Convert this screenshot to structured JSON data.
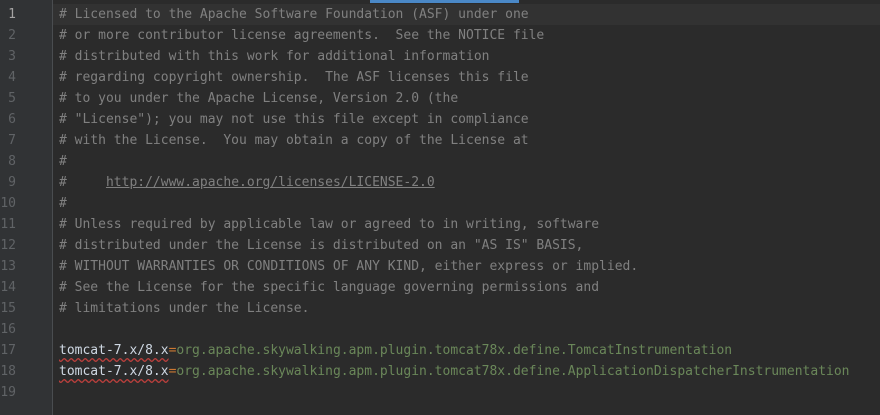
{
  "editor": {
    "current_line": 1,
    "line_numbers": [
      "1",
      "2",
      "3",
      "4",
      "5",
      "6",
      "7",
      "8",
      "9",
      "10",
      "11",
      "12",
      "13",
      "14",
      "15",
      "16",
      "17",
      "18",
      "19"
    ],
    "comments": [
      "# Licensed to the Apache Software Foundation (ASF) under one",
      "# or more contributor license agreements.  See the NOTICE file",
      "# distributed with this work for additional information",
      "# regarding copyright ownership.  The ASF licenses this file",
      "# to you under the Apache License, Version 2.0 (the",
      "# \"License\"); you may not use this file except in compliance",
      "# with the License.  You may obtain a copy of the License at",
      "#",
      "#     ",
      "#",
      "# Unless required by applicable law or agreed to in writing, software",
      "# distributed under the License is distributed on an \"AS IS\" BASIS,",
      "# WITHOUT WARRANTIES OR CONDITIONS OF ANY KIND, either express or implied.",
      "# See the License for the specific language governing permissions and",
      "# limitations under the License."
    ],
    "license_url": "http://www.apache.org/licenses/LICENSE-2.0",
    "properties": [
      {
        "key": "tomcat-7.x/8.x",
        "separator": "=",
        "value": "org.apache.skywalking.apm.plugin.tomcat78x.define.TomcatInstrumentation"
      },
      {
        "key": "tomcat-7.x/8.x",
        "separator": "=",
        "value": "org.apache.skywalking.apm.plugin.tomcat78x.define.ApplicationDispatcherInstrumentation"
      }
    ]
  }
}
